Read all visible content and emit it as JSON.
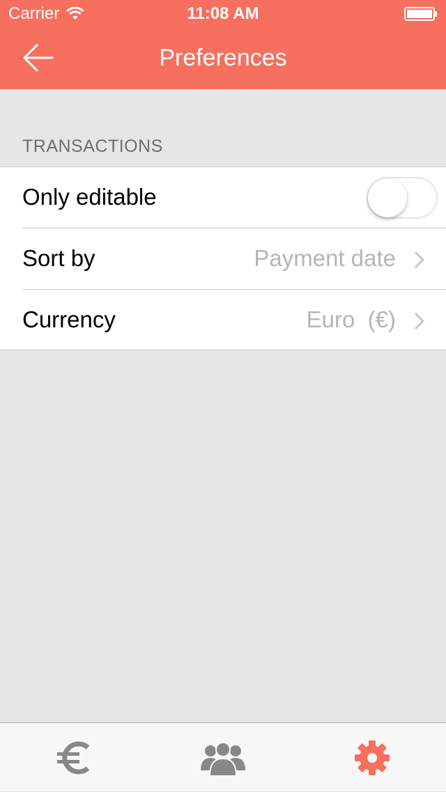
{
  "status_bar": {
    "carrier": "Carrier",
    "time": "11:08 AM"
  },
  "nav": {
    "title": "Preferences",
    "back_icon": "arrow-left-icon"
  },
  "section": {
    "header": "TRANSACTIONS",
    "rows": [
      {
        "label": "Only editable",
        "control": "toggle",
        "toggle_on": false
      },
      {
        "label": "Sort by",
        "value": "Payment date"
      },
      {
        "label": "Currency",
        "value": "Euro  (€)"
      }
    ]
  },
  "tab_bar": {
    "tabs": [
      {
        "icon": "euro-icon",
        "selected": false
      },
      {
        "icon": "people-icon",
        "selected": false
      },
      {
        "icon": "gear-icon",
        "selected": true
      }
    ]
  },
  "colors": {
    "accent": "#f76f5e",
    "tab_inactive": "#888888",
    "background": "#e6e6e6",
    "secondary_text": "#b5b5b5"
  }
}
